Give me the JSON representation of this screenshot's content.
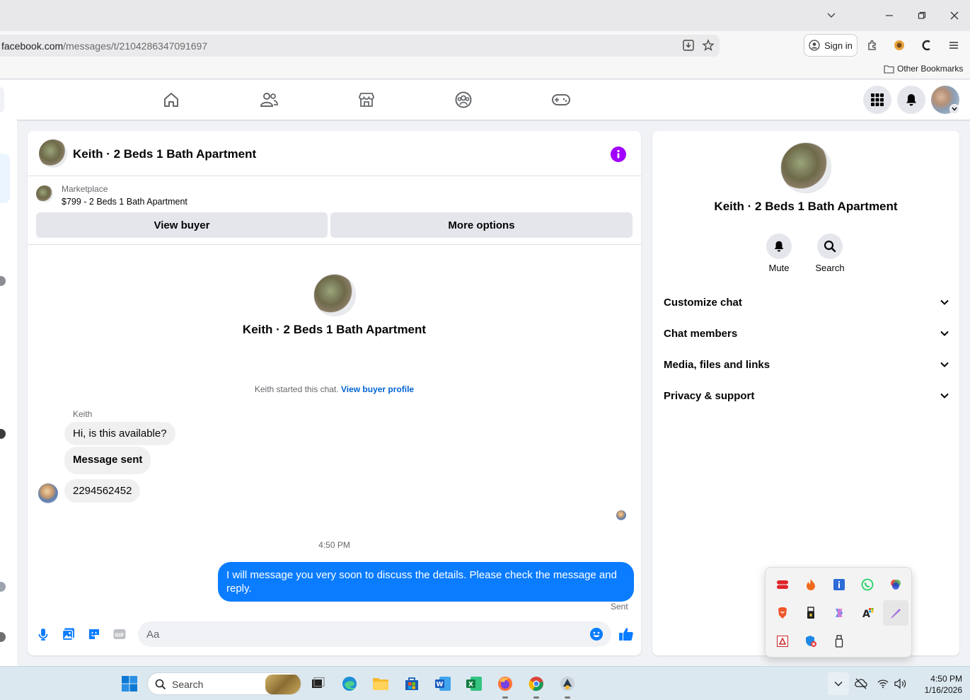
{
  "browser": {
    "url_domain": "facebook.com",
    "url_path": "/messages/t/2104286347091697",
    "signin_label": "Sign in",
    "other_bookmarks": "Other Bookmarks"
  },
  "chat": {
    "header_title": "Keith · 2 Beds 1 Bath Apartment",
    "marketplace_label": "Marketplace",
    "listing": "$799 - 2 Beds 1 Bath Apartment",
    "view_buyer": "View buyer",
    "more_options": "More options",
    "intro_name": "Keith · 2 Beds 1 Bath Apartment",
    "started_text": "Keith started this chat.",
    "view_buyer_profile": "View buyer profile",
    "sender_name": "Keith",
    "messages_in": [
      "Hi, is this available?",
      "Message sent",
      "2294562452"
    ],
    "timestamp": "4:50 PM",
    "message_out": "I will message you very soon to discuss the details. Please check the message and reply.",
    "sent_status": "Sent",
    "composer_placeholder": "Aa"
  },
  "right_panel": {
    "name": "Keith · 2 Beds 1 Bath Apartment",
    "mute": "Mute",
    "search": "Search",
    "sections": [
      "Customize chat",
      "Chat members",
      "Media, files and links",
      "Privacy & support"
    ]
  },
  "taskbar": {
    "search_label": "Search",
    "time": "4:50 PM",
    "date": "1/16/2026"
  },
  "colors": {
    "messenger_blue": "#0a7cff",
    "info_purple": "#a100ff",
    "link_blue": "#0064d1"
  }
}
